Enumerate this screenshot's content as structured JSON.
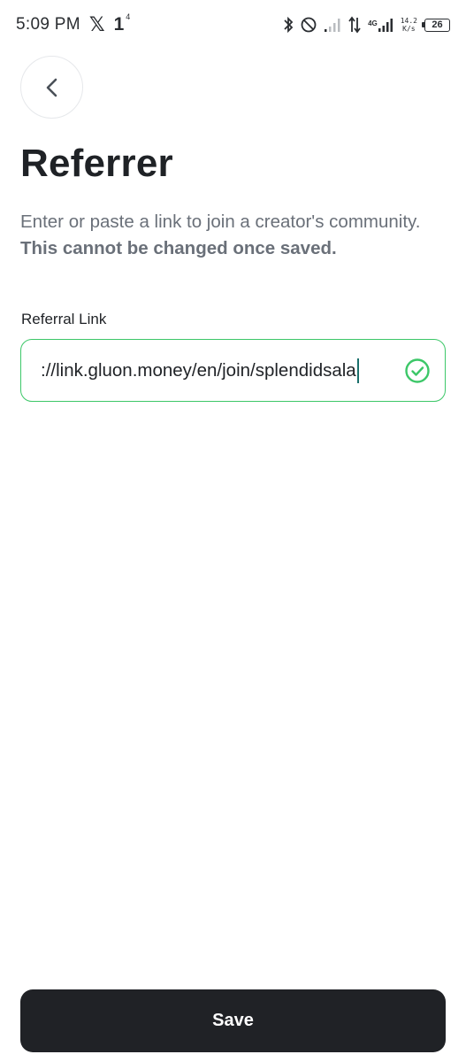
{
  "status_bar": {
    "time": "5:09 PM",
    "x_logo": "𝕏",
    "notif_count": "1",
    "notif_superscript": "4",
    "network_badge": "4G",
    "speed_value": "14.2",
    "speed_unit": "K/s",
    "battery": "26",
    "icons": [
      "x-logo-icon",
      "bluetooth-icon",
      "do-not-disturb-icon",
      "signal-icon",
      "data-arrows-icon",
      "signal-4g-icon",
      "battery-icon"
    ]
  },
  "header": {
    "back_icon": "chevron-left-icon",
    "title": "Referrer"
  },
  "description": {
    "text": "Enter or paste a link to join a creator's community. ",
    "bold_text": "This cannot be changed once saved."
  },
  "referral_field": {
    "label": "Referral Link",
    "value": "://link.gluon.money/en/join/splendidsala",
    "status_icon": "check-circle-icon"
  },
  "footer": {
    "save_label": "Save"
  },
  "colors": {
    "accent_green": "#3cc768",
    "button_dark": "#202226",
    "description_gray": "#6a7079"
  }
}
